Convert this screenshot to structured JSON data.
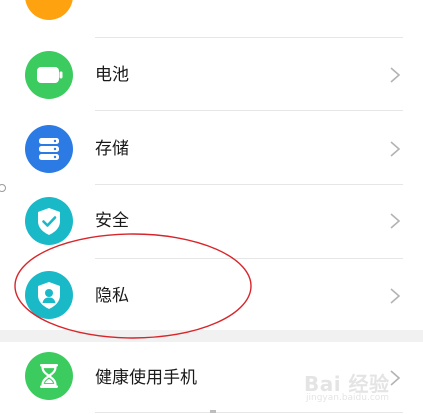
{
  "settings": {
    "top_partial_item": {
      "icon": "partial-orange-icon",
      "color": "#FFA20F"
    },
    "items": [
      {
        "label": "电池",
        "icon": "battery-icon",
        "color": "#3CCB5E"
      },
      {
        "label": "存储",
        "icon": "storage-icon",
        "color": "#2C7BE5"
      },
      {
        "label": "安全",
        "icon": "security-shield-icon",
        "color": "#19B9C8"
      },
      {
        "label": "隐私",
        "icon": "privacy-shield-icon",
        "color": "#19B9C8"
      },
      {
        "label": "健康使用手机",
        "icon": "hourglass-icon",
        "color": "#3CCB5E"
      }
    ],
    "chevron": "chevron-right-icon"
  },
  "annotation": {
    "shape": "ellipse",
    "color": "#D7262B",
    "target": "隐私"
  },
  "watermark": {
    "main": "Bai 经验",
    "sub": "jingyan.baidu.com"
  }
}
